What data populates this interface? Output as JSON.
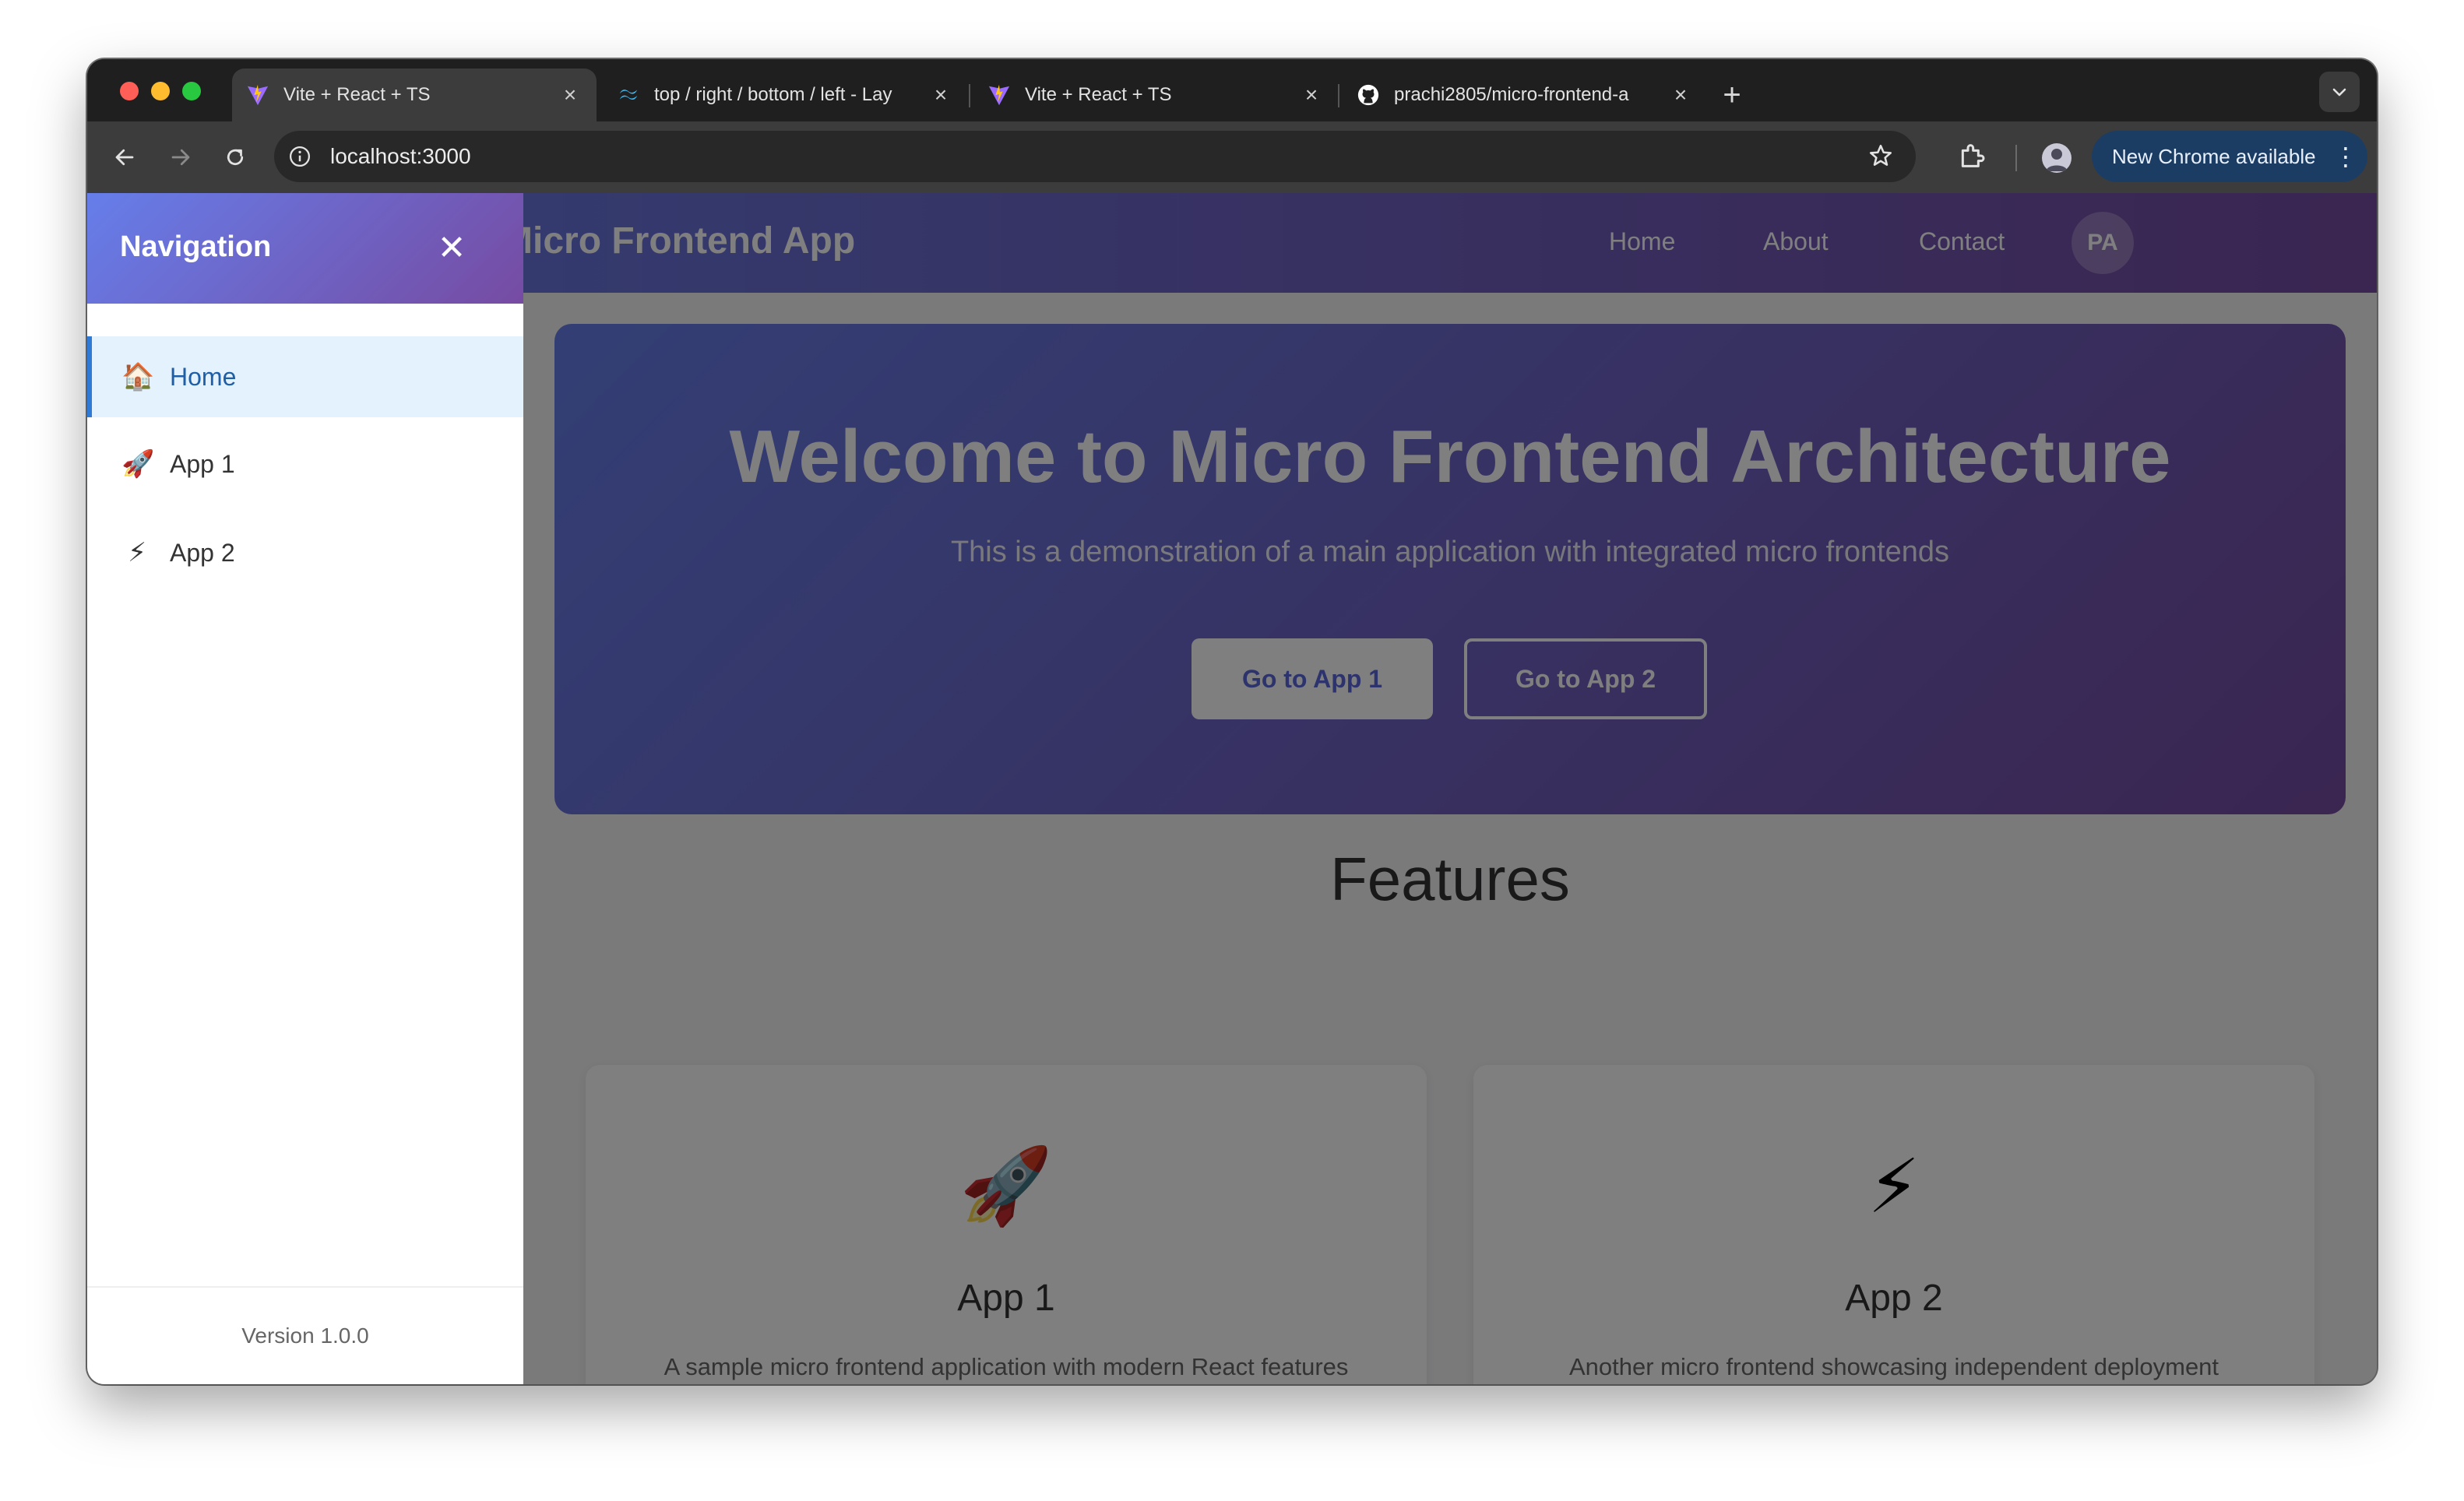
{
  "browser": {
    "tabs": [
      {
        "title": "Vite + React + TS",
        "favicon": "vite-icon",
        "active": true
      },
      {
        "title": "top / right / bottom / left - Lay",
        "favicon": "tailwind-icon",
        "active": false
      },
      {
        "title": "Vite + React + TS",
        "favicon": "vite-icon",
        "active": false
      },
      {
        "title": "prachi2805/micro-frontend-a",
        "favicon": "github-icon",
        "active": false
      }
    ],
    "url": "localhost:3000",
    "update_label": "New Chrome available",
    "update_menu_glyph": "⋮",
    "new_tab_glyph": "+",
    "close_glyph": "×"
  },
  "app": {
    "brand": "Micro Frontend App",
    "nav": [
      "Home",
      "About",
      "Contact"
    ],
    "avatar": "PA",
    "hero": {
      "title": "Welcome to Micro Frontend Architecture",
      "subtitle": "This is a demonstration of a main application with integrated micro frontends",
      "primary_button": "Go to App 1",
      "secondary_button": "Go to App 2"
    },
    "features_title": "Features",
    "cards": [
      {
        "icon": "🚀",
        "title": "App 1",
        "description": "A sample micro frontend application with modern React features"
      },
      {
        "icon": "⚡",
        "title": "App 2",
        "description": "Another micro frontend showcasing independent deployment"
      }
    ]
  },
  "drawer": {
    "title": "Navigation",
    "close_glyph": "✕",
    "items": [
      {
        "icon": "🏠",
        "label": "Home",
        "active": true
      },
      {
        "icon": "🚀",
        "label": "App 1",
        "active": false
      },
      {
        "icon": "⚡",
        "label": "App 2",
        "active": false
      }
    ],
    "footer": "Version 1.0.0"
  },
  "colors": {
    "header_gradient_start": "#667eea",
    "header_gradient_end": "#764ba2",
    "active_nav_bg": "#e3f2fd",
    "active_nav_text": "#1e5fa8",
    "chrome_update_pill": "#1c3d63"
  }
}
